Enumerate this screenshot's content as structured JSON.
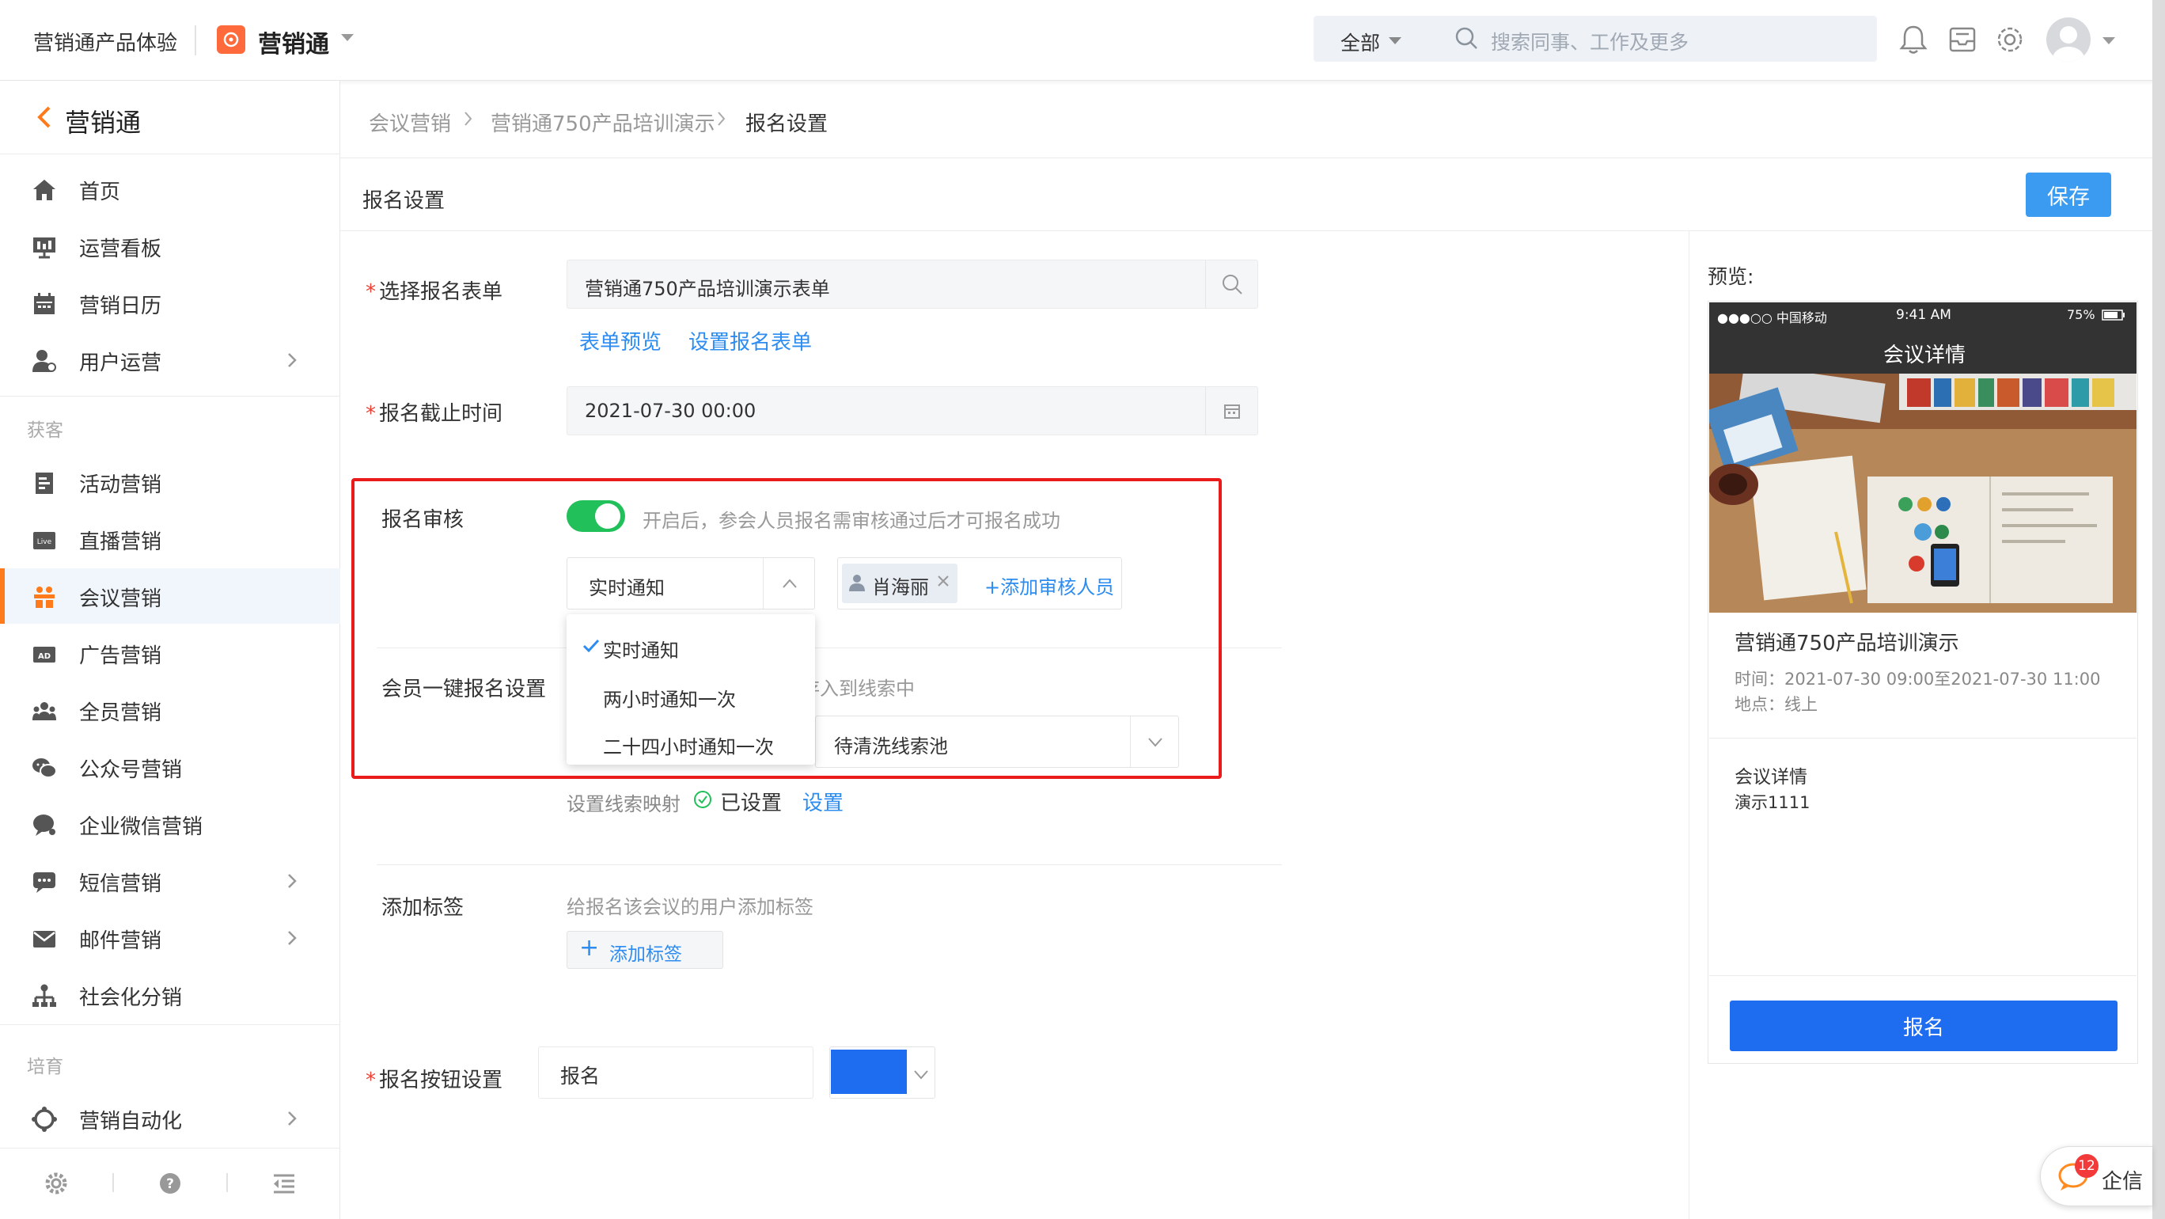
{
  "topbar": {
    "product_name": "营销通产品体验",
    "app_name": "营销通",
    "search_scope": "全部",
    "search_placeholder": "搜索同事、工作及更多",
    "icons": [
      "bell-icon",
      "inbox-icon",
      "gear-icon",
      "avatar"
    ]
  },
  "sidebar": {
    "title": "营销通",
    "items_top": [
      {
        "label": "首页",
        "icon": "home-icon"
      },
      {
        "label": "运营看板",
        "icon": "dashboard-icon"
      },
      {
        "label": "营销日历",
        "icon": "calendar-icon"
      },
      {
        "label": "用户运营",
        "icon": "user-icon",
        "has_children": true
      }
    ],
    "group_acquire": "获客",
    "items_acquire": [
      {
        "label": "活动营销",
        "icon": "activity-icon"
      },
      {
        "label": "直播营销",
        "icon": "live-icon"
      },
      {
        "label": "会议营销",
        "icon": "meeting-icon",
        "active": true
      },
      {
        "label": "广告营销",
        "icon": "ad-icon"
      },
      {
        "label": "全员营销",
        "icon": "team-icon"
      },
      {
        "label": "公众号营销",
        "icon": "wechat-icon"
      },
      {
        "label": "企业微信营销",
        "icon": "wecom-icon"
      },
      {
        "label": "短信营销",
        "icon": "sms-icon",
        "has_children": true
      },
      {
        "label": "邮件营销",
        "icon": "mail-icon",
        "has_children": true
      },
      {
        "label": "社会化分销",
        "icon": "distribution-icon"
      }
    ],
    "group_nurture": "培育",
    "items_nurture": [
      {
        "label": "营销自动化",
        "icon": "automation-icon",
        "has_children": true
      }
    ]
  },
  "breadcrumb": {
    "c1": "会议营销",
    "c2": "营销通750产品培训演示",
    "c3": "报名设置"
  },
  "header": {
    "title": "报名设置",
    "save_label": "保存"
  },
  "form": {
    "form_label": "选择报名表单",
    "form_value": "营销通750产品培训演示表单",
    "form_preview_link": "表单预览",
    "form_set_link": "设置报名表单",
    "deadline_label": "报名截止时间",
    "deadline_value": "2021-07-30 00:00",
    "review_label": "报名审核",
    "review_enabled": true,
    "review_hint": "开启后，参会人员报名需审核通过后才可报名成功",
    "notify_value": "实时通知",
    "notify_options": [
      "实时通知",
      "两小时通知一次",
      "二十四小时通知一次"
    ],
    "reviewer_name": "肖海丽",
    "add_reviewer": "+添加审核人员",
    "member_label": "会员一键报名设置",
    "member_hint": "存入到线索中",
    "clue_pool_value": "待清洗线索池",
    "mapping_label": "设置线索映射",
    "mapping_status": "已设置",
    "mapping_link": "设置",
    "tag_label": "添加标签",
    "tag_hint": "给报名该会议的用户添加标签",
    "tag_button": "添加标签",
    "button_label": "报名按钮设置",
    "button_text_value": "报名",
    "button_color": "#1e6cf0"
  },
  "preview": {
    "label": "预览:",
    "carrier": "●●●○○ 中国移动",
    "clock": "9:41 AM",
    "battery": "75%",
    "nav_title": "会议详情",
    "event_title": "营销通750产品培训演示",
    "event_time": "时间：2021-07-30 09:00至2021-07-30 11:00",
    "event_place": "地点：线上",
    "detail_title": "会议详情",
    "detail_body": "演示1111",
    "signup_label": "报名"
  },
  "qixin": {
    "badge": "12",
    "label": "企信"
  },
  "colors": {
    "accent": "#2d8cf0",
    "active_bar": "#ff7a1a",
    "toggle_on": "#21c05a",
    "highlight": "#ea1b1b"
  }
}
